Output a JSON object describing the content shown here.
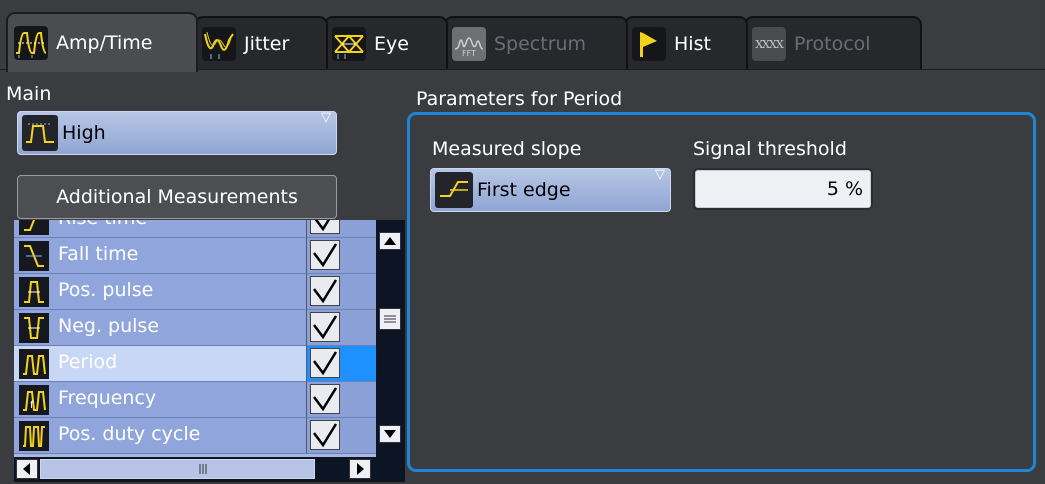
{
  "tabs": [
    {
      "label": "Amp/Time",
      "icon": "amp-time-icon",
      "active": true,
      "enabled": true
    },
    {
      "label": "Jitter",
      "icon": "jitter-icon",
      "active": false,
      "enabled": true
    },
    {
      "label": "Eye",
      "icon": "eye-diagram-icon",
      "active": false,
      "enabled": true
    },
    {
      "label": "Spectrum",
      "icon": "spectrum-fft-icon",
      "active": false,
      "enabled": false,
      "icon_text": "FFT"
    },
    {
      "label": "Hist",
      "icon": "histogram-flag-icon",
      "active": false,
      "enabled": true
    },
    {
      "label": "Protocol",
      "icon": "protocol-icon",
      "active": false,
      "enabled": false,
      "icon_text": "XXXX"
    }
  ],
  "main": {
    "label": "Main",
    "selected": "High",
    "icon": "pulse-high-icon"
  },
  "additional_button": "Additional Measurements",
  "measurements": [
    {
      "label": "Rise time",
      "checked": true,
      "icon": "rise-time-icon"
    },
    {
      "label": "Fall time",
      "checked": true,
      "icon": "fall-time-icon"
    },
    {
      "label": "Pos. pulse",
      "checked": true,
      "icon": "pos-pulse-icon"
    },
    {
      "label": "Neg. pulse",
      "checked": true,
      "icon": "neg-pulse-icon"
    },
    {
      "label": "Period",
      "checked": true,
      "icon": "period-icon",
      "selected": true
    },
    {
      "label": "Frequency",
      "checked": true,
      "icon": "frequency-icon"
    },
    {
      "label": "Pos. duty cycle",
      "checked": true,
      "icon": "duty-cycle-icon"
    }
  ],
  "params": {
    "title": "Parameters for Period",
    "slope_label": "Measured slope",
    "slope_value": "First edge",
    "slope_icon": "edge-slope-icon",
    "threshold_label": "Signal threshold",
    "threshold_value": "5 %"
  },
  "colors": {
    "accent": "#1e86d8",
    "selected_cell": "#1e90ff",
    "list_row": "#90a5db",
    "selected_row": "#c9d7f6",
    "waveform_yellow": "#f2d21a"
  }
}
